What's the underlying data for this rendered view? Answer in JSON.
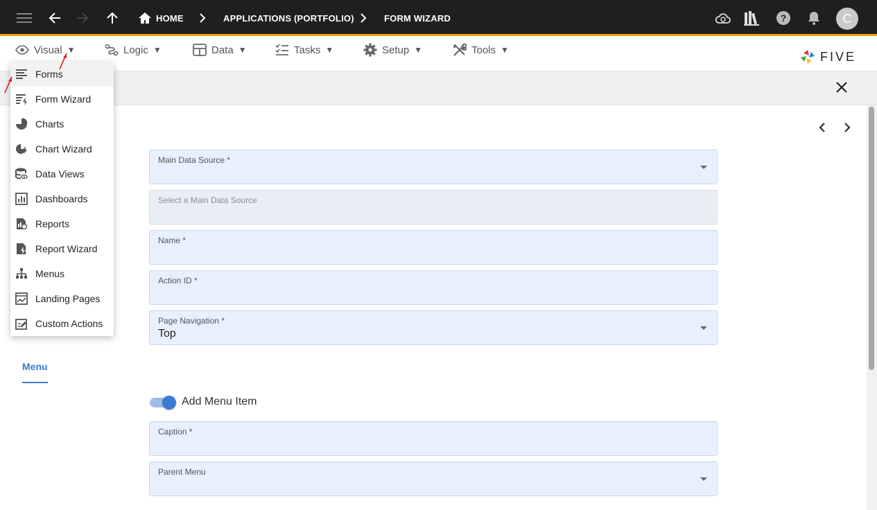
{
  "topbar": {
    "breadcrumbs": [
      "HOME",
      "APPLICATIONS (PORTFOLIO)",
      "FORM WIZARD"
    ],
    "avatar_initial": "C"
  },
  "menubar": {
    "items": [
      "Visual",
      "Logic",
      "Data",
      "Tasks",
      "Setup",
      "Tools"
    ],
    "caret": "▼",
    "logo_text": "FIVE"
  },
  "visual_menu": {
    "items": [
      "Forms",
      "Form Wizard",
      "Charts",
      "Chart Wizard",
      "Data Views",
      "Dashboards",
      "Reports",
      "Report Wizard",
      "Menus",
      "Landing Pages",
      "Custom Actions"
    ],
    "active_index": 0
  },
  "form": {
    "fields": [
      {
        "label": "Main Data Source *",
        "value": "",
        "type": "select"
      },
      {
        "label": "Select a Main Data Source",
        "value": "",
        "type": "disabled"
      },
      {
        "label": "Name *",
        "value": "",
        "type": "text"
      },
      {
        "label": "Action ID *",
        "value": "",
        "type": "text"
      },
      {
        "label": "Page Navigation *",
        "value": "Top",
        "type": "select"
      }
    ],
    "tab_label": "Menu",
    "toggle_label": "Add Menu Item",
    "toggle_on": true,
    "menu_fields": [
      {
        "label": "Caption *",
        "value": "",
        "type": "text"
      },
      {
        "label": "Parent Menu",
        "value": "",
        "type": "select"
      }
    ]
  },
  "colors": {
    "topbar_bg": "#1d1f21",
    "accent_line": "#f2a20c",
    "field_bg": "#e8f0fe",
    "link_blue": "#3a7bd5",
    "annotation_red": "#e02020"
  }
}
